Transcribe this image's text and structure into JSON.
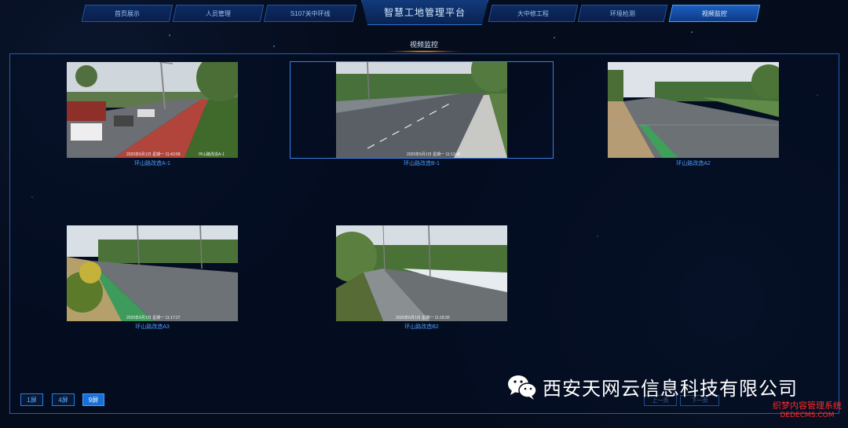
{
  "nav": {
    "tabs": [
      {
        "label": "首页展示",
        "active": false
      },
      {
        "label": "人员管理",
        "active": false
      },
      {
        "label": "S107关中环线",
        "active": false
      },
      {
        "label": "大中修工程",
        "active": false
      },
      {
        "label": "环境检测",
        "active": false
      },
      {
        "label": "视频监控",
        "active": true
      }
    ],
    "platform_title": "智慧工地管理平台"
  },
  "section": {
    "title": "视频监控"
  },
  "cameras": [
    {
      "label": "环山路改造A-1",
      "timestamp": "2020年6月1日 星期一 11:43:58",
      "site": "环山路改造A-1",
      "selected": false
    },
    {
      "label": "环山路改造B-1",
      "timestamp": "2020年6月1日 星期一 11:13:46",
      "site": "环山路改造B-1",
      "selected": true
    },
    {
      "label": "环山路改造A2",
      "timestamp": "",
      "site": "环山路改造A2",
      "selected": false
    },
    {
      "label": "环山路改造A3",
      "timestamp": "2020年6月1日 星期一 11:17:27",
      "site": "环山路改造A3",
      "selected": false
    },
    {
      "label": "环山路改造B2",
      "timestamp": "2020年6月1日 星期一 11:18:30",
      "site": "环山路改造B2",
      "selected": false
    }
  ],
  "screen_buttons": [
    {
      "label": "1屏",
      "active": false
    },
    {
      "label": "4屏",
      "active": false
    },
    {
      "label": "9屏",
      "active": true
    }
  ],
  "pager": {
    "prev": "上一页",
    "next": "下一页"
  },
  "watermark": {
    "company": "西安天网云信息科技有限公司",
    "site_name": "织梦内容管理系统",
    "site_url": "DEDECMS.COM"
  },
  "colors": {
    "accent": "#1a6fd6",
    "label": "#4a9dff",
    "border": "#1f5fb4",
    "watermark_red": "#ff2a2a"
  }
}
